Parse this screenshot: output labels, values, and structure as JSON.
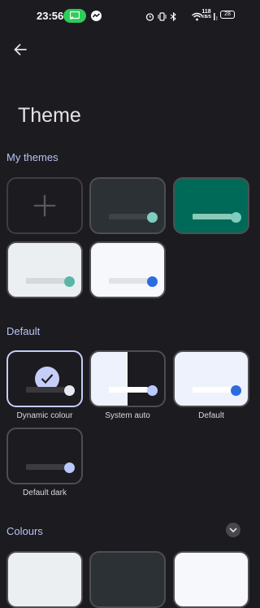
{
  "status_bar": {
    "time": "23:56",
    "network_speed_value": "118",
    "network_speed_unit": "KB/S",
    "battery_level": "28"
  },
  "header": {
    "title": "Theme"
  },
  "sections": {
    "my_themes": "My themes",
    "default": "Default",
    "colours": "Colours"
  },
  "default_themes": {
    "dynamic": "Dynamic colour",
    "system_auto": "System auto",
    "default": "Default",
    "default_dark": "Default dark"
  },
  "colors": {
    "background": "#1c1b1f",
    "section_label": "#b9c3f5",
    "selected_border": "#c5cdf8",
    "teal_dot": "#7fcdbf",
    "blue_dot": "#2b6de0",
    "light_blue_dot": "#b9c8ff"
  }
}
